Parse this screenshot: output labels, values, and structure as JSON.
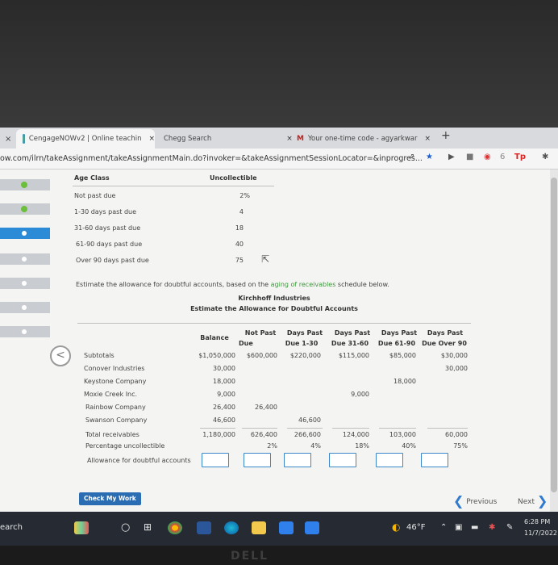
{
  "browser": {
    "tabs": [
      {
        "label": "CengageNOWv2 | Online teachin",
        "close": "×"
      },
      {
        "label": "Chegg Search",
        "close": "×"
      },
      {
        "label": "Your one-time code - agyarkwar",
        "close": "×"
      }
    ],
    "new_tab": "+",
    "url_prefix": "ow.com/ilrn/takeAssignment/takeAssignmentMain.do?invoker=&takeAssignmentSessionLocator=&inprogres...",
    "extensions": [
      "share",
      "★",
      "▶",
      "■",
      "6",
      "Tp",
      "✱"
    ]
  },
  "age_class_table": {
    "headers": [
      "Age Class",
      "Uncollectible"
    ],
    "rows": [
      [
        "Not past due",
        "2%"
      ],
      [
        "1-30 days past due",
        "4"
      ],
      [
        "31-60 days past due",
        "18"
      ],
      [
        "61-90 days past due",
        "40"
      ],
      [
        "Over 90 days past due",
        "75"
      ]
    ]
  },
  "instruction": {
    "text_before": "Estimate the allowance for doubtful accounts, based on the ",
    "link": "aging of receivables",
    "text_after": " schedule below."
  },
  "schedule": {
    "company": "Kirchhoff Industries",
    "title": "Estimate the Allowance for Doubtful Accounts",
    "headers": [
      [
        "Balance",
        ""
      ],
      [
        "Not Past",
        "Due"
      ],
      [
        "Days Past",
        "Due 1-30"
      ],
      [
        "Days Past",
        "Due 31-60"
      ],
      [
        "Days Past",
        "Due 61-90"
      ],
      [
        "Days Past",
        "Due Over 90"
      ]
    ],
    "rows": [
      {
        "label": "Subtotals",
        "values": [
          "$1,050,000",
          "$600,000",
          "$220,000",
          "$115,000",
          "$85,000",
          "$30,000"
        ]
      },
      {
        "label": "Conover Industries",
        "values": [
          "30,000",
          "",
          "",
          "",
          "",
          "30,000"
        ]
      },
      {
        "label": "Keystone Company",
        "values": [
          "18,000",
          "",
          "",
          "",
          "18,000",
          ""
        ]
      },
      {
        "label": "Moxie Creek Inc.",
        "values": [
          "9,000",
          "",
          "",
          "9,000",
          "",
          ""
        ]
      },
      {
        "label": "Rainbow Company",
        "values": [
          "26,400",
          "26,400",
          "",
          "",
          "",
          ""
        ]
      },
      {
        "label": "Swanson Company",
        "values": [
          "46,600",
          "",
          "46,600",
          "",
          "",
          ""
        ]
      },
      {
        "label": "Total receivables",
        "values": [
          "1,180,000",
          "626,400",
          "266,600",
          "124,000",
          "103,000",
          "60,000"
        ]
      },
      {
        "label": "Percentage uncollectible",
        "values": [
          "",
          "2%",
          "4%",
          "18%",
          "40%",
          "75%"
        ]
      }
    ],
    "allowance_label": "Allowance for doubtful accounts",
    "allowance_inputs": [
      "",
      "",
      "",
      "",
      "",
      ""
    ]
  },
  "nav": {
    "back": "<",
    "check_button": "Check My Work",
    "previous": "Previous",
    "next": "Next"
  },
  "taskbar": {
    "search": "earch",
    "weather": "46°F",
    "time": "6:28 PM",
    "date": "11/7/2022"
  },
  "brand": "DELL"
}
